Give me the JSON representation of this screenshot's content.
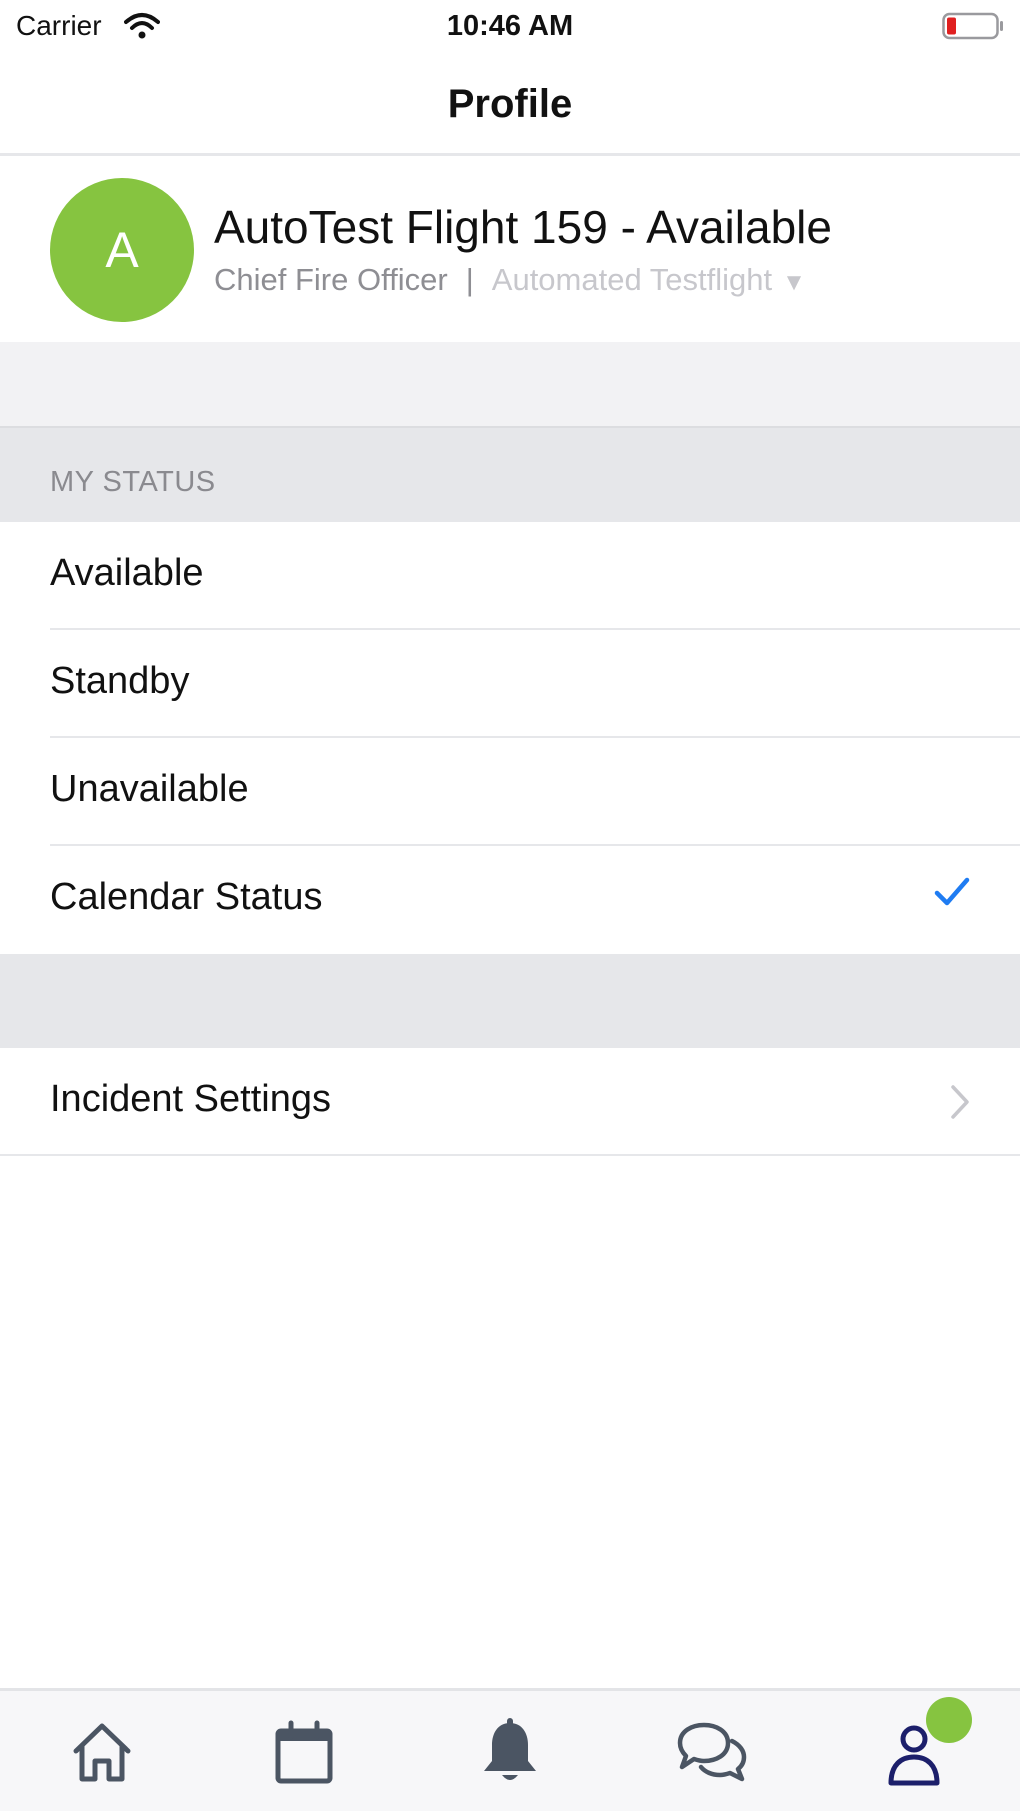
{
  "status_bar": {
    "carrier": "Carrier",
    "time": "10:46 AM",
    "battery_level": 0.15,
    "battery_color": "#e02020"
  },
  "nav": {
    "title": "Profile"
  },
  "profile": {
    "avatar_initial": "A",
    "avatar_color": "#86c440",
    "name": "AutoTest Flight 159 - Available",
    "role": "Chief Fire Officer",
    "separator": "|",
    "organization": "Automated Testflight",
    "organization_caret": "▼"
  },
  "my_status": {
    "header": "MY STATUS",
    "options": [
      {
        "label": "Available",
        "selected": false
      },
      {
        "label": "Standby",
        "selected": false
      },
      {
        "label": "Unavailable",
        "selected": false
      },
      {
        "label": "Calendar Status",
        "selected": true
      }
    ],
    "check_color": "#1f7cf2"
  },
  "settings": {
    "incident_settings_label": "Incident Settings"
  },
  "tab_bar": {
    "tabs": [
      {
        "icon": "home-icon",
        "selected": false
      },
      {
        "icon": "calendar-icon",
        "selected": false
      },
      {
        "icon": "bell-icon",
        "selected": false
      },
      {
        "icon": "chat-icon",
        "selected": false
      },
      {
        "icon": "profile-icon",
        "selected": true
      }
    ],
    "active_color": "#1c1f6b",
    "inactive_color": "#4b5563",
    "badge_color": "#86c440"
  }
}
